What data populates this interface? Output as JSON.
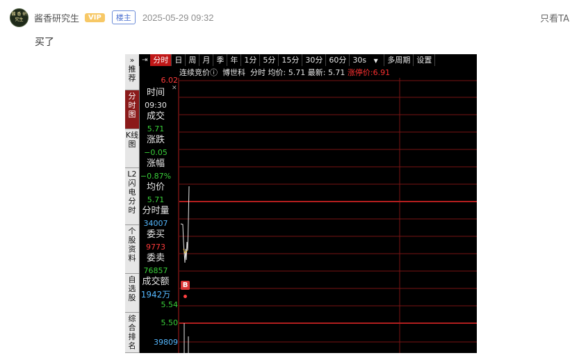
{
  "post": {
    "username": "酱香研究生",
    "vip_label": "VIP",
    "host_label": "楼主",
    "timestamp": "2025-05-29 09:32",
    "only_ta_label": "只看TA",
    "avatar_text": "酱 香 研究生",
    "text": "买了"
  },
  "app": {
    "side_tabs": [
      {
        "label": "» 推荐",
        "active": false
      },
      {
        "label": "分时图",
        "active": true
      },
      {
        "label": "K线图",
        "active": false
      },
      {
        "label": "L2闪电分时",
        "active": false
      },
      {
        "label": "个股资料",
        "active": false
      },
      {
        "label": "自选股",
        "active": false
      },
      {
        "label": "综合排名",
        "active": false
      }
    ],
    "toolbar": [
      "分时",
      "日",
      "周",
      "月",
      "季",
      "年",
      "1分",
      "5分",
      "15分",
      "30分",
      "60分",
      "30s",
      "多周期",
      "设置"
    ],
    "toolbar_active": "分时",
    "toolbar_dropdown_arrow": "▼",
    "info": {
      "auction": "连续竞价",
      "stock_name": "博世科",
      "mode": "分时",
      "avg_label": "均价:",
      "avg_value": "5.71",
      "latest_label": "最新:",
      "latest_value": "5.71",
      "limit_label": "涨停价:",
      "limit_value": "6.91"
    },
    "stats": {
      "time_label": "时间",
      "time_value": "09:30",
      "volume_label": "成交",
      "volume_value": "5.71",
      "change_label": "涨跌",
      "change_value": "−0.05",
      "pct_label": "涨幅",
      "pct_value": "−0.87%",
      "avg_label": "均价",
      "avg_value": "5.71",
      "minute_vol_label": "分时量",
      "minute_vol_value": "34007",
      "bid_label": "委买",
      "bid_value": "9773",
      "ask_label": "委卖",
      "ask_value": "76857",
      "turnover_label": "成交额",
      "turnover_value": "1942万"
    },
    "yaxis": {
      "top": "6.02",
      "mid1": "5.54",
      "mid2": "5.50",
      "volume": "39809"
    },
    "buy_marker": "B",
    "colors": {
      "grid": "#8b1a1a",
      "up": "#ff3b3b",
      "down": "#3ad13a",
      "volume": "#55b8ff"
    }
  }
}
